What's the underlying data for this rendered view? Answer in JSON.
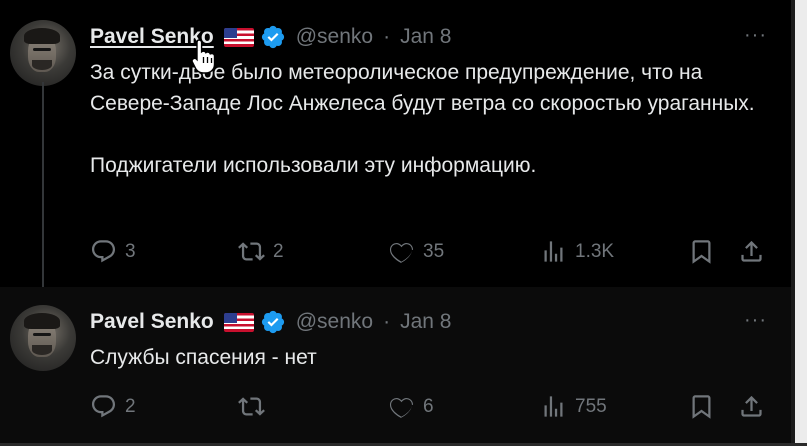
{
  "tweets": [
    {
      "author": {
        "name": "Pavel Senko",
        "handle": "@senko",
        "separator": "·",
        "date": "Jan 8",
        "flag_icon": "us-flag-icon",
        "verified_color": "#1d9bf0"
      },
      "paragraphs": [
        "За сутки-двое было метеоролическое предупреждение, что на Севере-Западе Лос Анжелеса будут ветра со скоростью ураганных.",
        "Поджигатели использовали эту информацию."
      ],
      "stats": {
        "replies": "3",
        "retweets": "2",
        "likes": "35",
        "views": "1.3K"
      }
    },
    {
      "author": {
        "name": "Pavel Senko",
        "handle": "@senko",
        "separator": "·",
        "date": "Jan 8",
        "flag_icon": "us-flag-icon",
        "verified_color": "#1d9bf0"
      },
      "paragraphs": [
        "Службы спасения - нет"
      ],
      "stats": {
        "replies": "2",
        "retweets": "",
        "likes": "6",
        "views": "755"
      }
    }
  ],
  "more_label": "···",
  "colors": {
    "background": "#000000",
    "text": "#e7e9ea",
    "muted": "#71767b",
    "accent": "#1d9bf0"
  }
}
